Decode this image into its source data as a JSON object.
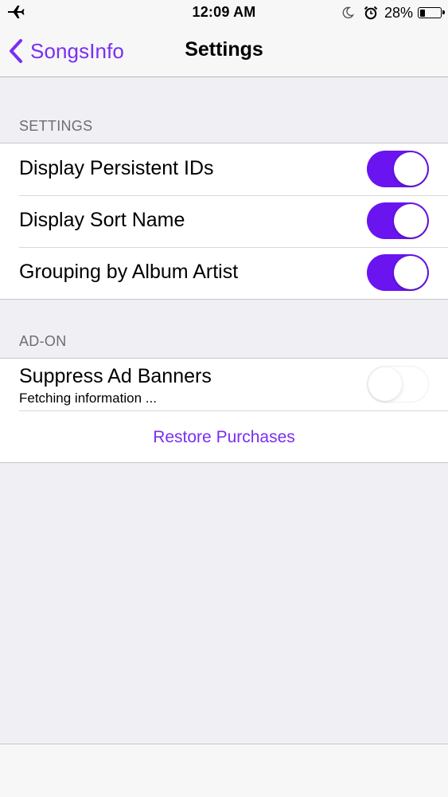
{
  "status_bar": {
    "time": "12:09 AM",
    "battery_percent": "28%",
    "battery_level": 0.28,
    "icons": [
      "airplane-icon",
      "moon-icon",
      "alarm-icon",
      "battery-icon"
    ]
  },
  "nav": {
    "back_label": "SongsInfo",
    "title": "Settings"
  },
  "sections": [
    {
      "header": "SETTINGS",
      "rows": [
        {
          "label": "Display Persistent IDs",
          "on": true
        },
        {
          "label": "Display Sort Name",
          "on": true
        },
        {
          "label": "Grouping by Album Artist",
          "on": true
        }
      ]
    },
    {
      "header": "AD-ON",
      "rows": [
        {
          "label": "Suppress Ad Banners",
          "sublabel": "Fetching information ...",
          "on": false,
          "enabled": false
        },
        {
          "link": "Restore Purchases"
        }
      ]
    }
  ],
  "colors": {
    "accent": "#7a2ff0",
    "toggle_on": "#6a14f0",
    "background": "#efeff4",
    "section_header": "#6d6d72"
  }
}
